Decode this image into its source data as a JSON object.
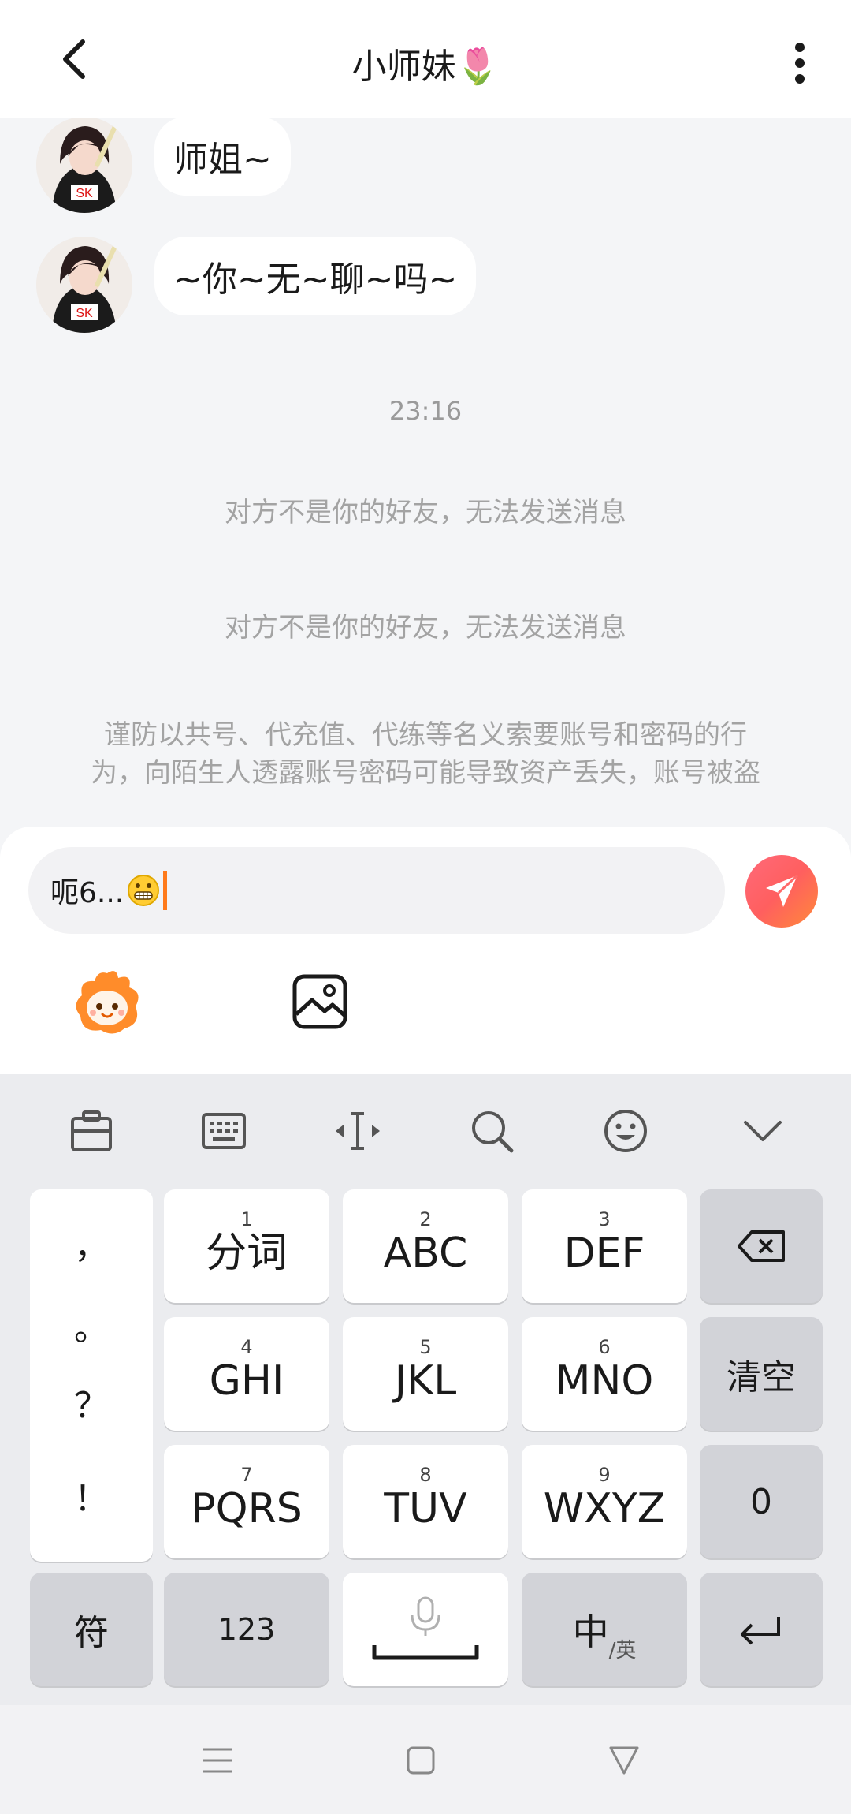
{
  "header": {
    "title": "小师妹",
    "title_emoji": "🌷",
    "back_icon": "chevron-left-icon",
    "more_icon": "more-vertical-icon"
  },
  "messages": [
    {
      "sender": "other",
      "text": "师姐~"
    },
    {
      "sender": "other",
      "text": "~你~无~聊~吗~"
    }
  ],
  "timestamp": "23:16",
  "system_notices": [
    "对方不是你的好友，无法发送消息",
    "对方不是你的好友，无法发送消息"
  ],
  "warning": {
    "line1": "谨防以共号、代充值、代练等名义索要账号和密码的行",
    "line2": "为，向陌生人透露账号密码可能导致资产丢失，账号被盗"
  },
  "composer": {
    "input_value": "呃6...",
    "input_emoji": "grimacing-face-emoji",
    "send_icon": "paper-plane-icon",
    "sticker_icon": "sticker-mascot-icon",
    "image_icon": "image-icon",
    "accent": "#ff6a6a"
  },
  "keyboard": {
    "toolbar": [
      "clipboard-icon",
      "keyboard-icon",
      "cursor-icon",
      "search-icon",
      "emoji-icon",
      "collapse-icon"
    ],
    "punctuation": [
      "，",
      "。",
      "？",
      "！"
    ],
    "keys": [
      {
        "num": "1",
        "label": "分词"
      },
      {
        "num": "2",
        "label": "ABC"
      },
      {
        "num": "3",
        "label": "DEF"
      },
      {
        "num": "4",
        "label": "GHI"
      },
      {
        "num": "5",
        "label": "JKL"
      },
      {
        "num": "6",
        "label": "MNO"
      },
      {
        "num": "7",
        "label": "PQRS"
      },
      {
        "num": "8",
        "label": "TUV"
      },
      {
        "num": "9",
        "label": "WXYZ"
      }
    ],
    "right_keys": {
      "clear": "清空",
      "zero": "0"
    },
    "bottom_row": {
      "symbols": "符",
      "numbers": "123",
      "lang_main": "中",
      "lang_sub": "/英"
    }
  },
  "navbar": [
    "menu-icon",
    "home-square-icon",
    "back-triangle-icon"
  ]
}
